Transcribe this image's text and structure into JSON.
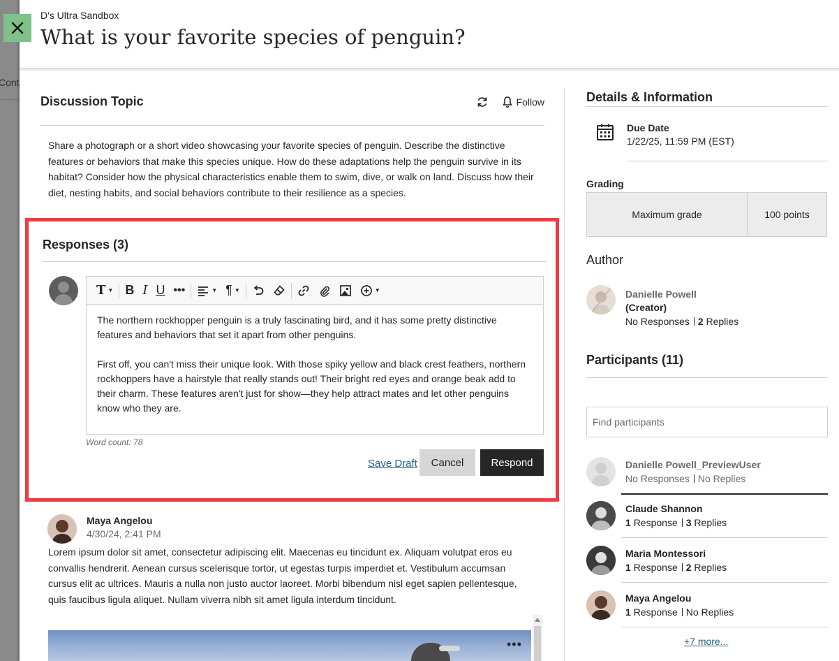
{
  "backdrop": {
    "ghost_text": "Conter"
  },
  "course": {
    "name": "D's Ultra Sandbox"
  },
  "title": "What is your favorite species of penguin?",
  "topic": {
    "heading": "Discussion Topic",
    "follow_label": "Follow",
    "body": "Share a photograph or a short video showcasing your favorite species of penguin. Describe the distinctive features or behaviors that make this species unique. How do these adaptations help the penguin survive in its habitat? Consider how the physical characteristics enable them to swim, dive, or walk on land. Discuss how their diet, nesting habits, and social behaviors contribute to their resilience as a species."
  },
  "responses": {
    "heading": "Responses (3)",
    "editor_paragraphs": [
      "The northern rockhopper penguin is a truly fascinating bird, and it has some pretty distinctive features and behaviors that set it apart from other penguins.",
      "First off, you can't miss their unique look. With those spiky yellow and black crest feathers, northern rockhoppers have a hairstyle that really stands out! Their bright red eyes and orange beak add to their charm. These features aren't just for show—they help attract mates and let other penguins know who they are."
    ],
    "word_count": "Word count: 78",
    "save_draft": "Save Draft",
    "cancel": "Cancel",
    "respond": "Respond"
  },
  "post": {
    "author": "Maya Angelou",
    "date": "4/30/24, 2:41 PM",
    "text": "Lorem ipsum dolor sit amet, consectetur adipiscing elit. Maecenas eu tincidunt ex. Aliquam volutpat eros eu convallis hendrerit. Aenean cursus scelerisque tortor, ut egestas turpis imperdiet et. Vestibulum accumsan cursus elit ac ultrices. Mauris a nulla non justo auctor laoreet. Morbi bibendum nisl eget sapien pellentesque, quis faucibus ligula aliquet. Nullam viverra nibh sit amet ligula interdum tincidunt."
  },
  "details": {
    "heading": "Details & Information",
    "due_label": "Due Date",
    "due_value": "1/22/25, 11:59 PM (EST)",
    "grading_label": "Grading",
    "grade_name": "Maximum grade",
    "grade_value": "100 points"
  },
  "author": {
    "heading": "Author",
    "name": "Danielle Powell",
    "role": "(Creator)",
    "responses": "No Responses",
    "replies_count": "2",
    "replies_word": "Replies"
  },
  "participants": {
    "heading": "Participants (11)",
    "search_placeholder": "Find participants",
    "items": [
      {
        "name": "Danielle Powell_PreviewUser",
        "responses": "No Responses",
        "replies": "No Replies"
      },
      {
        "name": "Claude Shannon",
        "responses_count": "1",
        "responses_word": "Response",
        "replies_count": "3",
        "replies_word": "Replies"
      },
      {
        "name": "Maria Montessori",
        "responses_count": "1",
        "responses_word": "Response",
        "replies_count": "2",
        "replies_word": "Replies"
      },
      {
        "name": "Maya Angelou",
        "responses_count": "1",
        "responses_word": "Response",
        "replies": "No Replies"
      }
    ],
    "more_link": "+7 more..."
  },
  "colors": {
    "highlight_border": "#ef3b44",
    "close_button": "#7ec28a",
    "link": "#2a5f8a",
    "primary_button": "#262626"
  }
}
